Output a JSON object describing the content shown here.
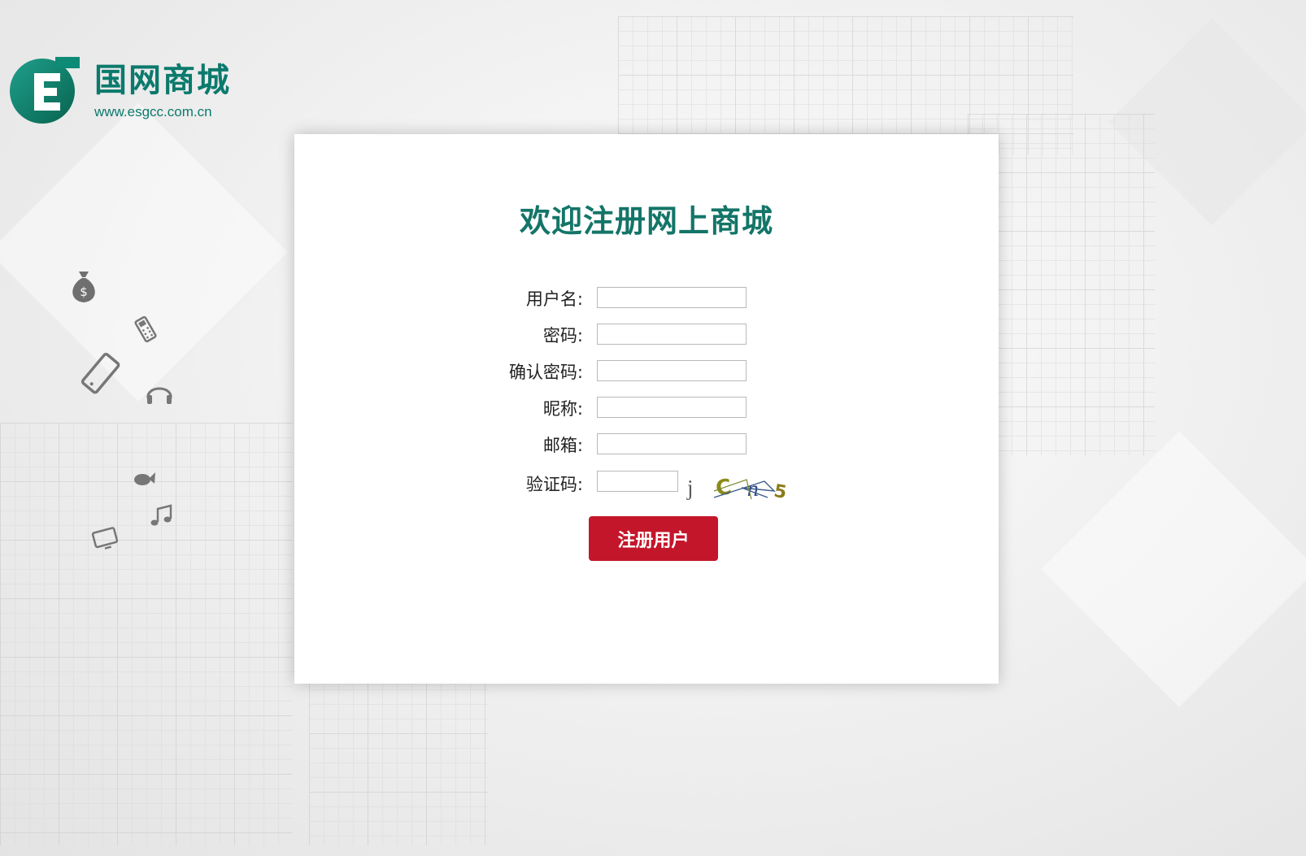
{
  "brand": {
    "name": "国网商城",
    "url": "www.esgcc.com.cn",
    "color": "#0b7a6d"
  },
  "form": {
    "title": "欢迎注册网上商城",
    "fields": [
      {
        "label": "用户名:",
        "value": ""
      },
      {
        "label": "密码:",
        "value": ""
      },
      {
        "label": "确认密码:",
        "value": ""
      },
      {
        "label": "昵称:",
        "value": ""
      },
      {
        "label": "邮箱:",
        "value": ""
      },
      {
        "label": "验证码:",
        "value": ""
      }
    ],
    "captcha_text": "jCn5",
    "submit_label": "注册用户",
    "submit_color": "#c4162a",
    "title_color": "#137568"
  },
  "decor_icons": [
    "money-bag-icon",
    "calculator-icon",
    "smartphone-icon",
    "headphones-icon",
    "fish-icon",
    "music-note-icon",
    "tv-icon"
  ]
}
